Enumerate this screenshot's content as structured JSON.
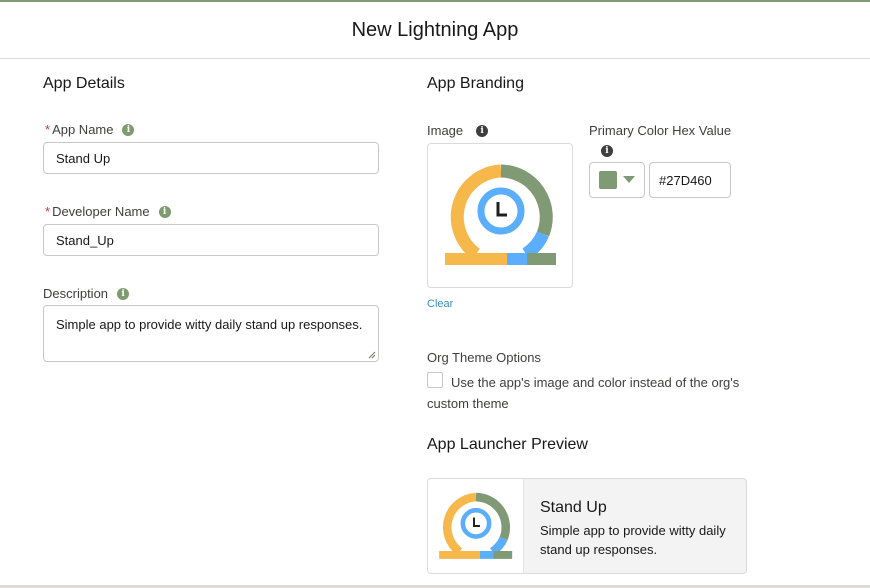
{
  "window": {
    "title": "New Lightning App"
  },
  "app_details": {
    "title": "App Details",
    "app_name": {
      "required_mark": "*",
      "label": "App Name",
      "value": "Stand Up"
    },
    "developer_name": {
      "required_mark": "*",
      "label": "Developer Name",
      "value": "Stand_Up"
    },
    "description": {
      "label": "Description",
      "value": "Simple app to provide witty daily stand up responses."
    }
  },
  "app_branding": {
    "title": "App Branding",
    "image_label": "Image",
    "clear_link": "Clear",
    "primary_color_label": "Primary Color Hex Value",
    "primary_color_value": "#27D460",
    "swatch_color": "#7f9a74",
    "org_theme": {
      "label": "Org Theme Options",
      "checkbox_checked": false,
      "checkbox_label": "Use the app's image and color instead of the org's custom theme"
    }
  },
  "launcher_preview": {
    "title": "App Launcher Preview",
    "app_title": "Stand Up",
    "app_description": "Simple app to provide witty daily stand up responses."
  },
  "icons": {
    "info": "info-icon",
    "app_logo": "stand-up-clock-logo-icon",
    "color_dropdown": "chevron-down-icon"
  },
  "colors": {
    "logo_orange": "#f7b84b",
    "logo_green": "#7f9a74",
    "logo_blue": "#5aaefc",
    "info_green": "#7e9a6e"
  }
}
